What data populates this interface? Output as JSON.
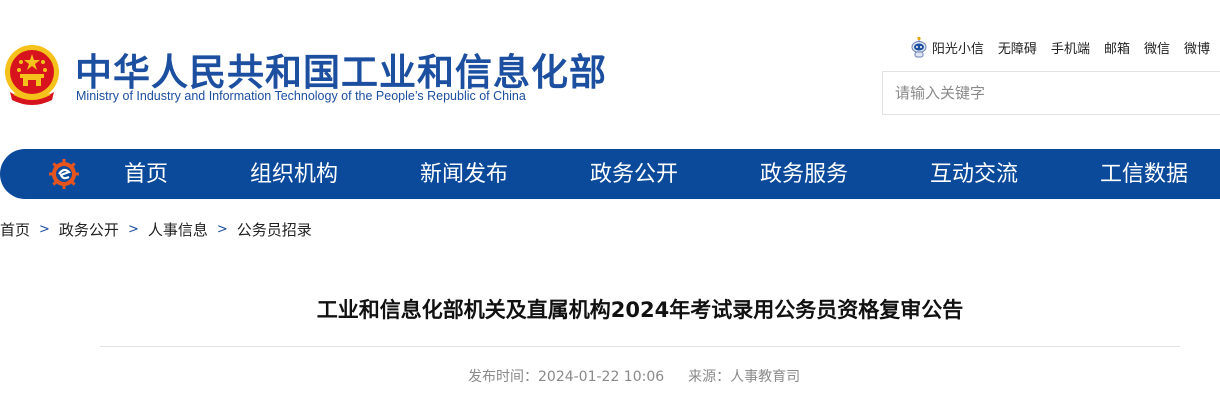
{
  "header": {
    "site_title": "中华人民共和国工业和信息化部",
    "site_subtitle": "Ministry of Industry and Information Technology of the People’s Republic of China",
    "emblem_icon": "national-emblem-icon",
    "toplinks": [
      "阳光小信",
      "无障碍",
      "手机端",
      "邮箱",
      "微信",
      "微博"
    ],
    "search_placeholder": "请输入关键字"
  },
  "nav": {
    "logo_icon": "miit-logo-icon",
    "items": [
      "首页",
      "组织机构",
      "新闻发布",
      "政务公开",
      "政务服务",
      "互动交流",
      "工信数据"
    ]
  },
  "breadcrumb": {
    "items": [
      "首页",
      "政务公开",
      "人事信息",
      "公务员招录"
    ],
    "separator": ">"
  },
  "article": {
    "title": "工业和信息化部机关及直属机构2024年考试录用公务员资格复审公告",
    "publish_label": "发布时间：",
    "publish_time": "2024-01-22 10:06",
    "source_label": "来源：",
    "source": "人事教育司"
  },
  "colors": {
    "brand_blue": "#1c4fa0",
    "nav_blue": "#0b4a9a",
    "emblem_red": "#d7141d",
    "emblem_gold": "#f5c21b"
  }
}
